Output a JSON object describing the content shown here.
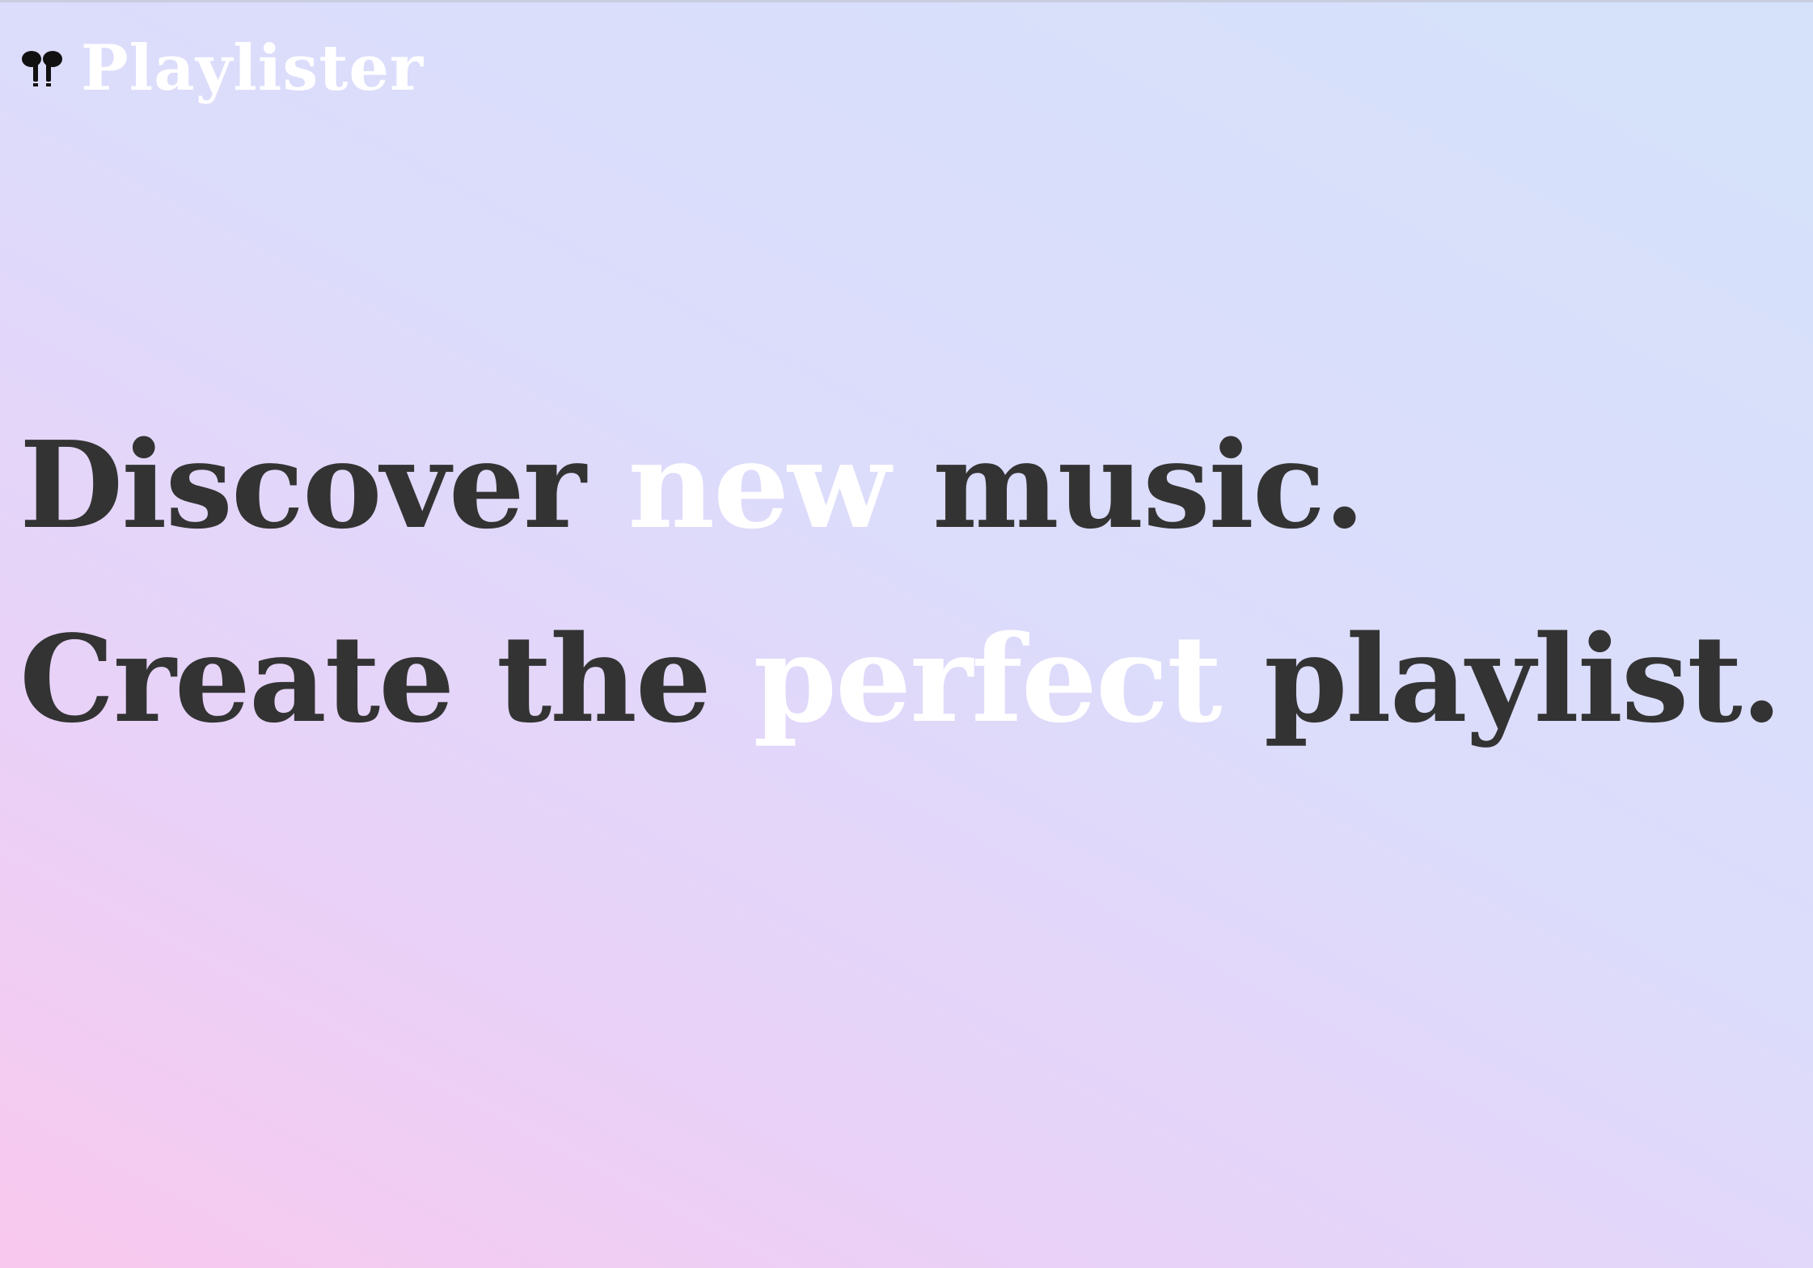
{
  "app": {
    "name": "Playlister",
    "logo_icon": "earbuds-icon"
  },
  "hero": {
    "segments": [
      {
        "text": "Discover ",
        "color": "#333333"
      },
      {
        "text": "new",
        "color": "#ffffff"
      },
      {
        "text": " music. Create the ",
        "color": "#333333"
      },
      {
        "text": "perfect",
        "color": "#ffffff"
      },
      {
        "text": " playlist.",
        "color": "#333333"
      }
    ]
  },
  "colors": {
    "background_gradient": [
      "#f9c8ee",
      "#e8d2f8",
      "#dcdcfb",
      "#d5e2fa"
    ],
    "text_dark": "#333333",
    "text_light": "#ffffff"
  }
}
